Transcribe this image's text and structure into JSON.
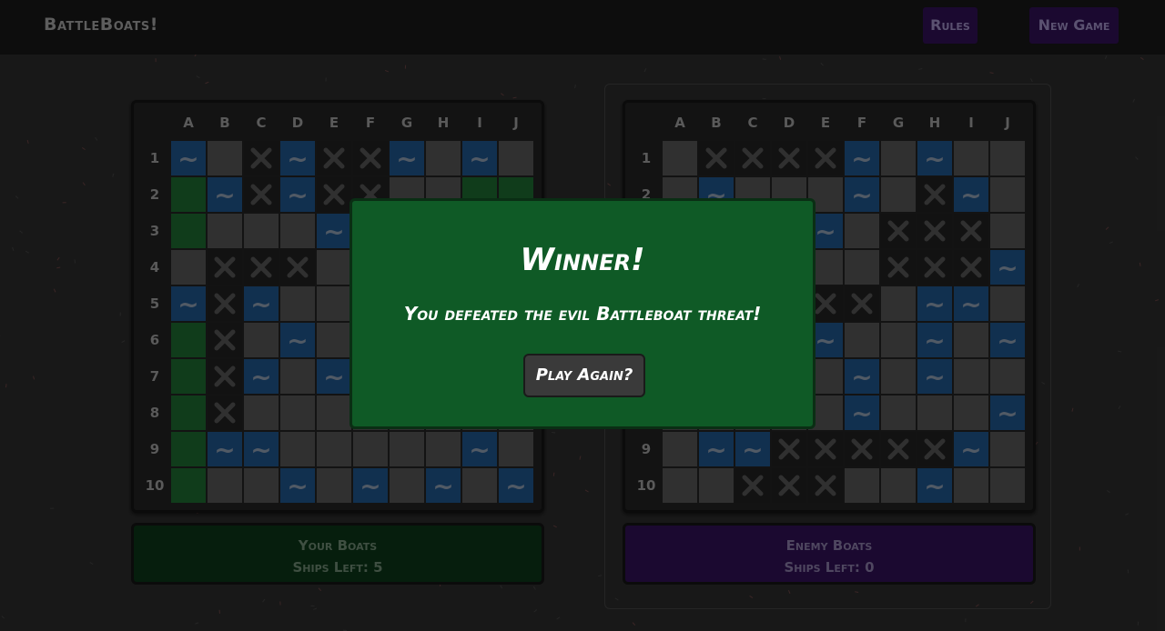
{
  "header": {
    "brand": "BattleBoats!",
    "rules_label": "Rules",
    "new_game_label": "New Game",
    "accent_color": "#2a0f4a"
  },
  "columns": [
    "A",
    "B",
    "C",
    "D",
    "E",
    "F",
    "G",
    "H",
    "I",
    "J"
  ],
  "rows": [
    "1",
    "2",
    "3",
    "4",
    "5",
    "6",
    "7",
    "8",
    "9",
    "10"
  ],
  "icons": {
    "water": "wave-icon",
    "hit": "x-mark-icon"
  },
  "colors": {
    "empty": "#4a4a4a",
    "water": "#1b4a7a",
    "hit": "#1c1c1c",
    "ship": "#1a5c2a"
  },
  "player_board": {
    "grid": [
      "W.XWXXW.W.",
      "SWXWXX..SS",
      "S...W.....",
      ".XXX......",
      "WXW.......",
      "SX.W......",
      "SXW.W.....",
      "SX........",
      "SWW.....W.",
      "S..W.W.W.W"
    ]
  },
  "enemy_board": {
    "grid": [
      ".XXXXW.W..",
      ".W...W.XW.",
      "....W.XXX.",
      "......XXXW",
      "....XX.WW.",
      "....W..W.W",
      ".....W.W..",
      ".....W...W",
      ".WWXXXXXW.",
      "..XXX..W.."
    ]
  },
  "status": {
    "yours_title": "Your Boats",
    "yours_ships": "Ships Left: 5",
    "enemy_title": "Enemy Boats",
    "enemy_ships": "Ships Left: 0"
  },
  "modal": {
    "title": "Winner!",
    "message": "You defeated the evil Battleboat threat!",
    "button_label": "Play Again?"
  }
}
